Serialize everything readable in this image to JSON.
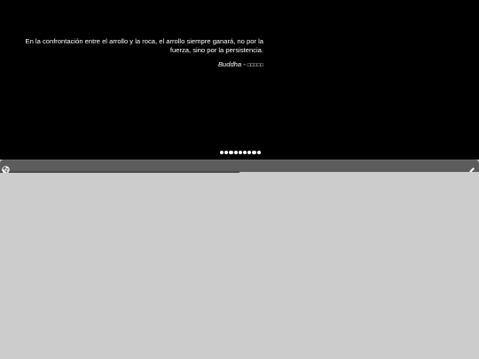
{
  "quote": {
    "text": "En la confrontación entre el arrollo y la roca, el arrollo siempre ganará, no por la fuerza, sino por la persistencia.",
    "author": "Buddha",
    "separator": " - ",
    "author_native": "□□□□□"
  },
  "slider": {
    "dot_count": 9,
    "active_index": 0
  },
  "toolbar": {
    "logo_icon": "chrome-logo-icon",
    "edit_icon": "pencil-icon",
    "progress": 0.5
  },
  "colors": {
    "panel_bg": "#000000",
    "toolbar_bg": "#5c5c5c",
    "content_bg": "#cccccc",
    "text": "#ffffff"
  }
}
